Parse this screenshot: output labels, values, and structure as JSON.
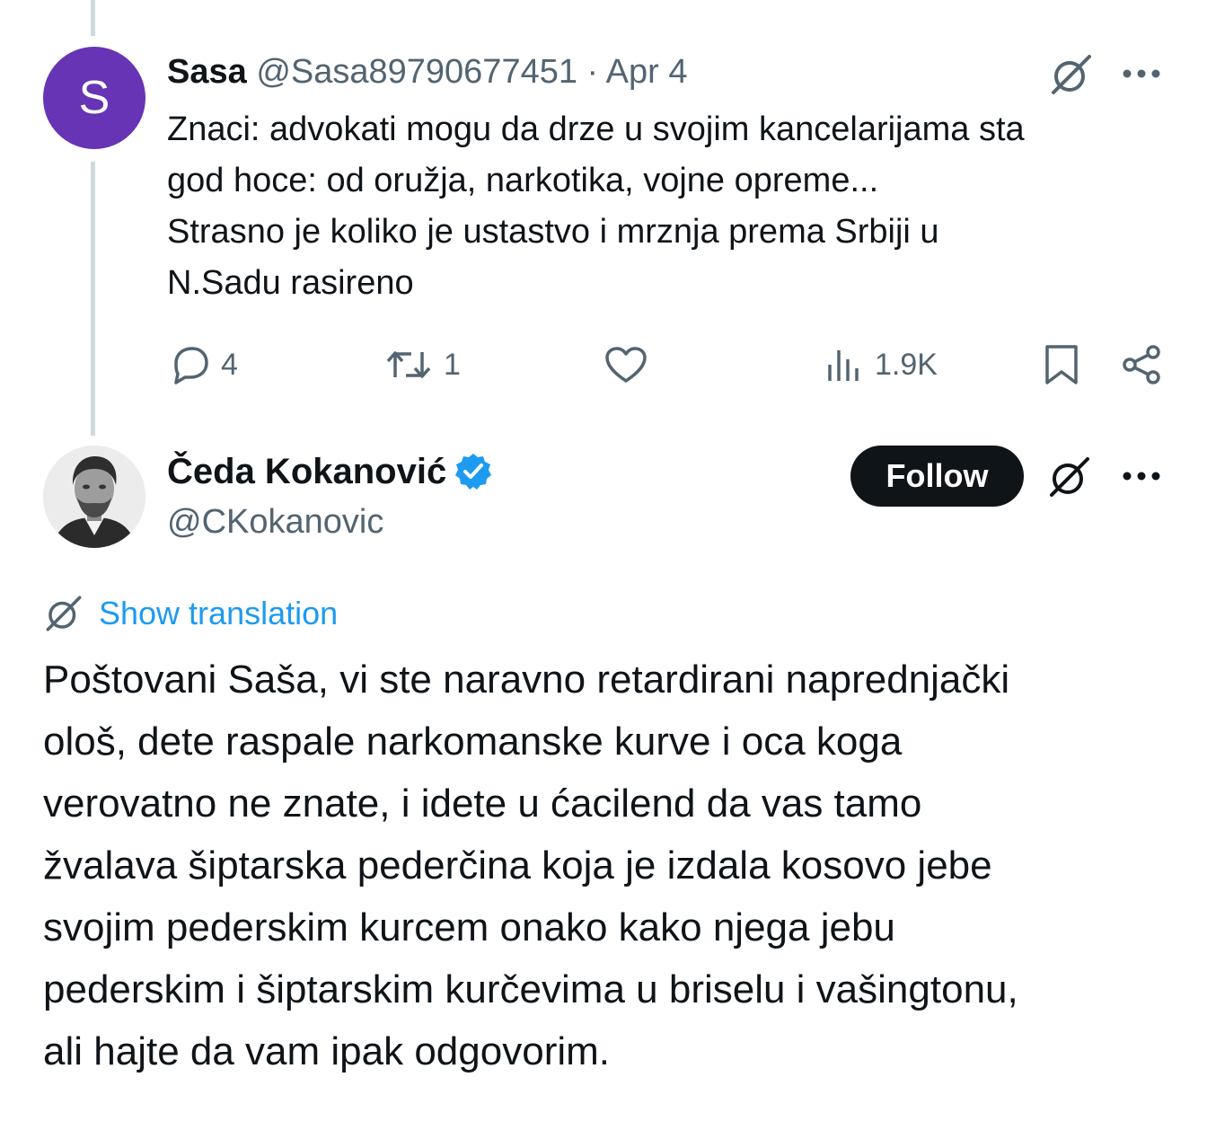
{
  "reply_tweet": {
    "avatar_letter": "S",
    "avatar_color": "#6634b4",
    "name": "Sasa",
    "handle": "@Sasa89790677451",
    "separator": "·",
    "date": "Apr 4",
    "text_lines": [
      "Znaci: advokati mogu da drze u svojim kancelarijama sta",
      "god hoce: od oružja, narkotika, vojne opreme...",
      "Strasno je koliko je ustastvo i mrznja prema Srbiji u",
      "N.Sadu rasireno"
    ],
    "actions": {
      "replies": "4",
      "reposts": "1",
      "likes": "",
      "views": "1.9K"
    },
    "icons": [
      "grok-icon",
      "more-icon",
      "reply-icon",
      "repost-icon",
      "like-icon",
      "views-icon",
      "bookmark-icon",
      "share-icon"
    ]
  },
  "main_tweet": {
    "name": "Čeda Kokanović",
    "handle": "@CKokanovic",
    "verified": true,
    "verified_color": "#1d9bf0",
    "follow_label": "Follow",
    "translation_label": "Show translation",
    "text_lines": [
      "Poštovani Saša, vi ste naravno retardirani naprednjački",
      "ološ, dete raspale narkomanske kurve i oca koga",
      "verovatno ne znate, i idete u ćacilend da vas tamo",
      "žvalava šiptarska pederčina koja je izdala kosovo jebe",
      "svojim pederskim kurcem onako kako njega jebu",
      "pederskim i šiptarskim kurčevima u briselu i vašingtonu,",
      "ali hajte da vam ipak odgovorim."
    ]
  },
  "colors": {
    "text": "#0f1419",
    "muted": "#536471",
    "link": "#1d9bf0",
    "thread_line": "#cfd9de"
  }
}
